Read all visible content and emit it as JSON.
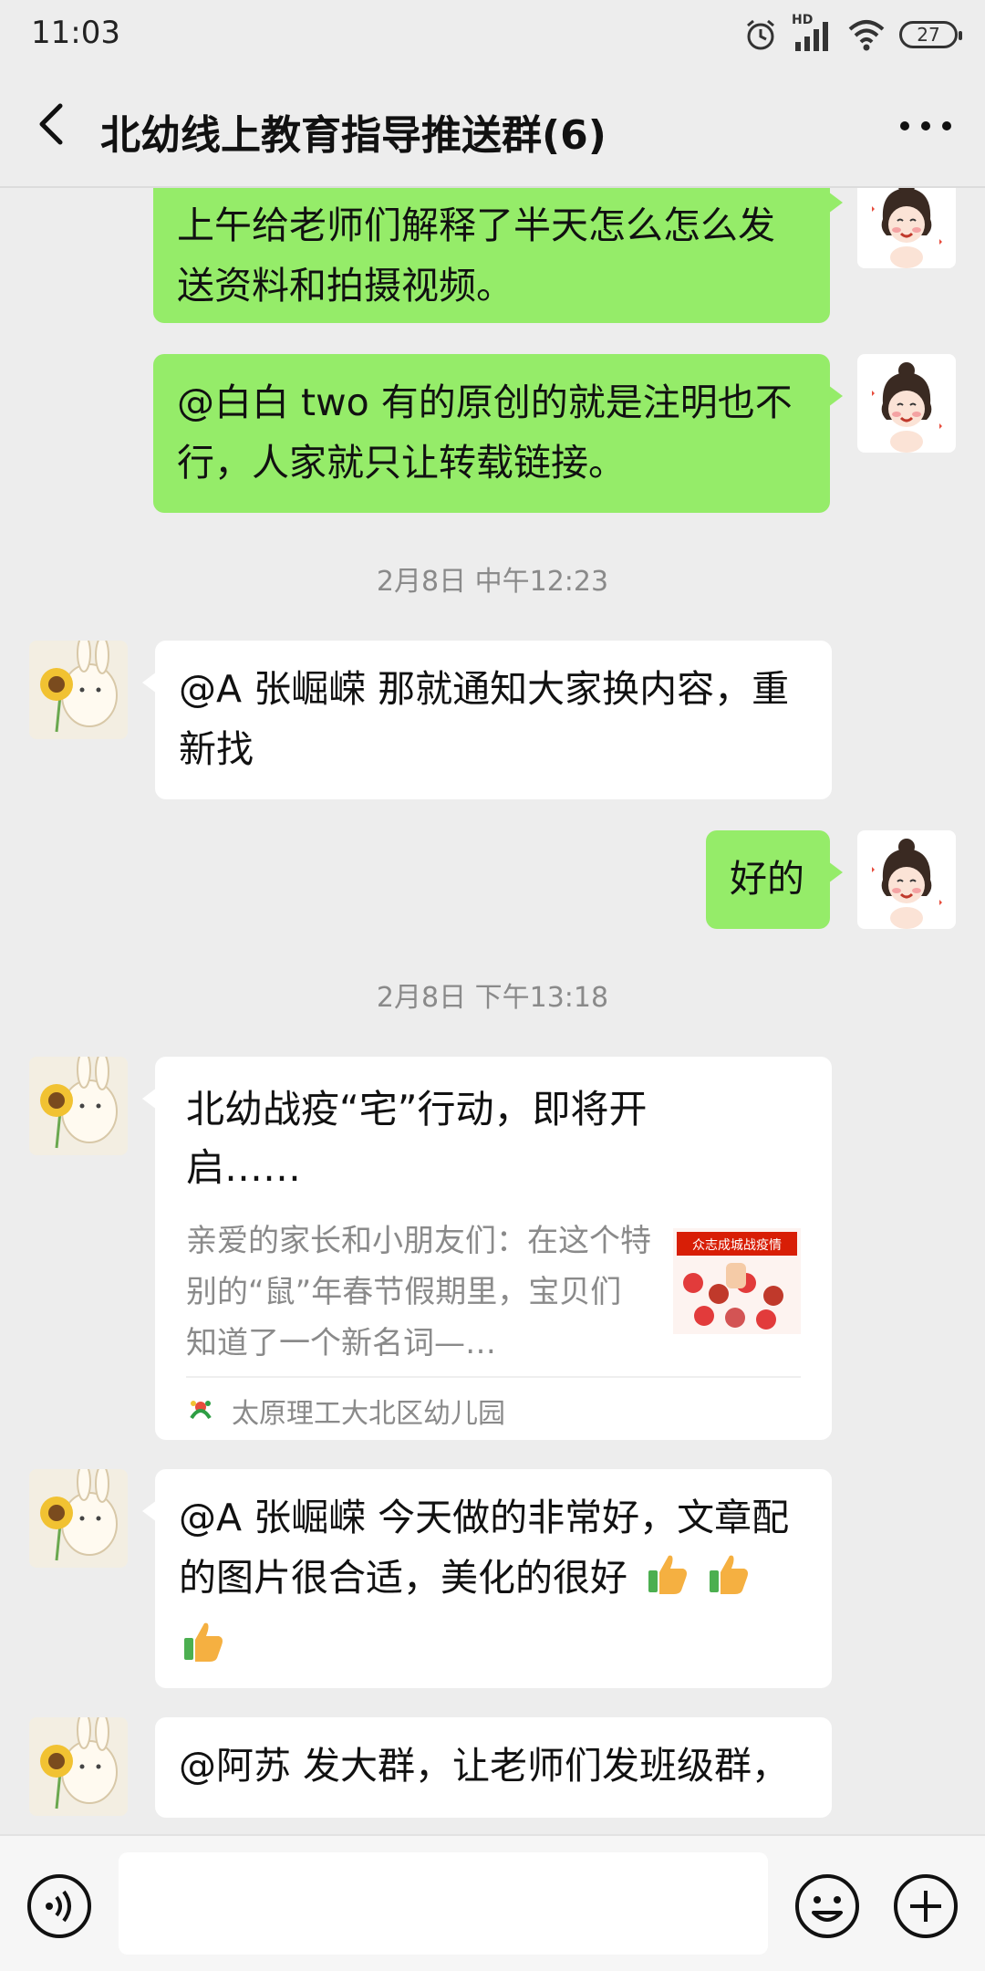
{
  "status_bar": {
    "time": "11:03",
    "network": "HD",
    "battery": "27"
  },
  "header": {
    "title": "北幼线上教育指导推送群(6)"
  },
  "messages": {
    "m1": {
      "text": "上午给老师们解释了半天怎么怎么发送资料和拍摄视频。"
    },
    "m2": {
      "text": "@白白 two  有的原创的就是注明也不行，人家就只让转载链接。"
    },
    "ts1": "2月8日 中午12:23",
    "m3": {
      "text": "@A 张崛嵘  那就通知大家换内容，重新找"
    },
    "m4": {
      "text": "好的"
    },
    "ts2": "2月8日 下午13:18",
    "card": {
      "title": "北幼战疫“宅”行动，即将开启……",
      "desc": "亲爱的家长和小朋友们：在这个特别的“鼠”年春节假期里，宝贝们知道了一个新名词—…",
      "thumb_text": "众志成城战疫情",
      "source": "太原理工大北区幼儿园"
    },
    "m5": {
      "text": "@A 张崛嵘  今天做的非常好，文章配的图片很合适，美化的很好"
    },
    "m6": {
      "text": "@阿苏  发大群，让老师们发班级群，"
    }
  },
  "input": {
    "placeholder": ""
  },
  "colors": {
    "outgoing_bubble": "#95ec69",
    "incoming_bubble": "#ffffff",
    "background": "#ededed"
  }
}
